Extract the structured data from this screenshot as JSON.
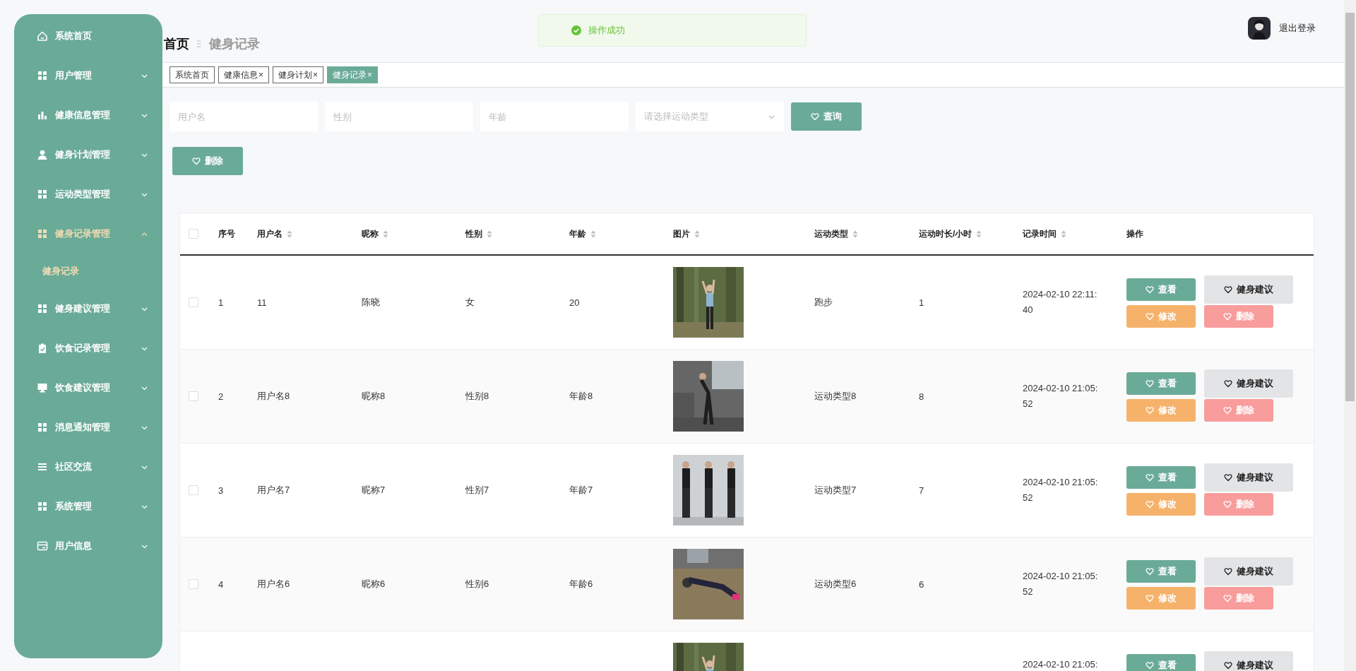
{
  "sidebar": {
    "items": [
      {
        "label": "系统首页",
        "expanded": false,
        "has_arrow": false
      },
      {
        "label": "用户管理",
        "expanded": false,
        "has_arrow": true
      },
      {
        "label": "健康信息管理",
        "expanded": false,
        "has_arrow": true
      },
      {
        "label": "健身计划管理",
        "expanded": false,
        "has_arrow": true
      },
      {
        "label": "运动类型管理",
        "expanded": false,
        "has_arrow": true
      },
      {
        "label": "健身记录管理",
        "expanded": true,
        "has_arrow": true,
        "children": [
          {
            "label": "健身记录",
            "selected": true
          }
        ]
      },
      {
        "label": "健身建议管理",
        "expanded": false,
        "has_arrow": true
      },
      {
        "label": "饮食记录管理",
        "expanded": false,
        "has_arrow": true
      },
      {
        "label": "饮食建议管理",
        "expanded": false,
        "has_arrow": true
      },
      {
        "label": "消息通知管理",
        "expanded": false,
        "has_arrow": true
      },
      {
        "label": "社区交流",
        "expanded": false,
        "has_arrow": true
      },
      {
        "label": "系统管理",
        "expanded": false,
        "has_arrow": true
      },
      {
        "label": "用户信息",
        "expanded": false,
        "has_arrow": true
      }
    ]
  },
  "breadcrumb": [
    "首页",
    "健身记录"
  ],
  "toast": {
    "text": "操作成功"
  },
  "header": {
    "logout": "退出登录"
  },
  "tabs": [
    {
      "label": "系统首页",
      "selected": false
    },
    {
      "label": "健康信息",
      "close": "×",
      "selected": false
    },
    {
      "label": "健身计划",
      "close": "×",
      "selected": false
    },
    {
      "label": "健身记录",
      "close": "×",
      "selected": true
    }
  ],
  "filters": {
    "fields": [
      {
        "kind": "input",
        "placeholder": "用户名"
      },
      {
        "kind": "input",
        "placeholder": "性别"
      },
      {
        "kind": "input",
        "placeholder": "年龄"
      },
      {
        "kind": "select",
        "placeholder": "请选择运动类型"
      }
    ],
    "search_button": "查询",
    "delete_button": "删除"
  },
  "table": {
    "select_all_checked": false,
    "columns": [
      {
        "label": "序号",
        "sortable": false
      },
      {
        "label": "用户名",
        "sortable": true
      },
      {
        "label": "昵称",
        "sortable": true
      },
      {
        "label": "性别",
        "sortable": true
      },
      {
        "label": "年龄",
        "sortable": true
      },
      {
        "label": "图片",
        "sortable": true
      },
      {
        "label": "运动类型",
        "sortable": true
      },
      {
        "label": "运动时长/小时",
        "sortable": true
      },
      {
        "label": "记录时间",
        "sortable": true
      },
      {
        "label": "操作",
        "sortable": false
      }
    ],
    "rows": [
      {
        "checked": false,
        "cells": [
          "1",
          "11",
          "陈晓",
          "女",
          "20",
          "",
          "跑步",
          "1",
          "2024-02-10 22:11:40"
        ],
        "actions": [
          [
            {
              "kind": "view",
              "label": "查看"
            },
            {
              "kind": "advice",
              "label": "健身建议"
            }
          ],
          [
            {
              "kind": "edit",
              "label": "修改"
            },
            {
              "kind": "delete",
              "label": "删除"
            }
          ]
        ]
      },
      {
        "checked": false,
        "cells": [
          "2",
          "用户名8",
          "昵称8",
          "性别8",
          "年龄8",
          "",
          "运动类型8",
          "8",
          "2024-02-10 21:05:52"
        ],
        "actions": [
          [
            {
              "kind": "view",
              "label": "查看"
            },
            {
              "kind": "advice",
              "label": "健身建议"
            }
          ],
          [
            {
              "kind": "edit",
              "label": "修改"
            },
            {
              "kind": "delete",
              "label": "删除"
            }
          ]
        ]
      },
      {
        "checked": false,
        "cells": [
          "3",
          "用户名7",
          "昵称7",
          "性别7",
          "年龄7",
          "",
          "运动类型7",
          "7",
          "2024-02-10 21:05:52"
        ],
        "actions": [
          [
            {
              "kind": "view",
              "label": "查看"
            },
            {
              "kind": "advice",
              "label": "健身建议"
            }
          ],
          [
            {
              "kind": "edit",
              "label": "修改"
            },
            {
              "kind": "delete",
              "label": "删除"
            }
          ]
        ]
      },
      {
        "checked": false,
        "cells": [
          "4",
          "用户名6",
          "昵称6",
          "性别6",
          "年龄6",
          "",
          "运动类型6",
          "6",
          "2024-02-10 21:05:52"
        ],
        "actions": [
          [
            {
              "kind": "view",
              "label": "查看"
            },
            {
              "kind": "advice",
              "label": "健身建议"
            }
          ],
          [
            {
              "kind": "edit",
              "label": "修改"
            },
            {
              "kind": "delete",
              "label": "删除"
            }
          ]
        ]
      },
      {
        "cells": [
          "",
          "",
          "",
          "",
          "",
          "",
          "",
          "",
          "2024-02-10 21:05:"
        ],
        "actions": [
          [
            {
              "kind": "view",
              "label": "查看"
            },
            {
              "kind": "advice",
              "label": "健身建议"
            }
          ]
        ]
      }
    ]
  }
}
